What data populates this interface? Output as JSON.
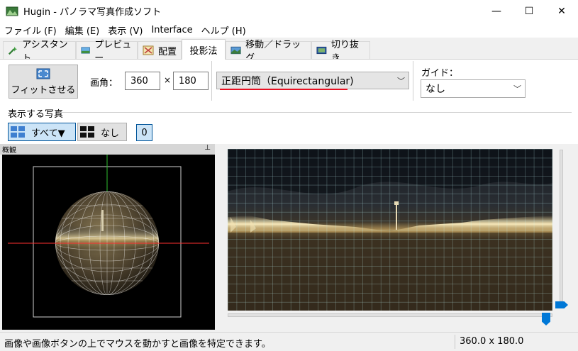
{
  "window": {
    "title": "Hugin - パノラマ写真作成ソフト",
    "minimize_glyph": "—",
    "maximize_glyph": "☐",
    "close_glyph": "✕"
  },
  "menu": [
    "ファイル (F)",
    "編集 (E)",
    "表示 (V)",
    "Interface",
    "ヘルプ (H)"
  ],
  "tabs": [
    {
      "label": "アシスタント",
      "icon": "wand-icon"
    },
    {
      "label": "プレビュー",
      "icon": "preview-icon"
    },
    {
      "label": "配置",
      "icon": "layout-icon"
    },
    {
      "label": "投影法",
      "icon": "",
      "active": true
    },
    {
      "label": "移動／ドラッグ",
      "icon": "move-icon"
    },
    {
      "label": "切り抜き",
      "icon": "crop-icon"
    }
  ],
  "projection": {
    "fit_button": "フィットさせる",
    "fov_label": "画角：",
    "fov_h": "360",
    "fov_x": "×",
    "fov_v": "180",
    "projection_value": "正距円筒（Equirectangular)",
    "guide_label": "ガイド：",
    "guide_value": "なし"
  },
  "images": {
    "section_label": "表示する写真",
    "all_button": "すべて▼",
    "none_button": "なし",
    "count": "0"
  },
  "overview": {
    "title": "概観",
    "pin_glyph": "⊥"
  },
  "status": {
    "message": "画像や画像ボタンの上でマウスを動かすと画像を特定できます。",
    "fov": "360.0 x 180.0"
  },
  "colors": {
    "accent": "#0078d7",
    "underline": "#e81123",
    "horizon": "#ff3030",
    "meridian": "#30c030",
    "grid": "#c8ffff"
  }
}
